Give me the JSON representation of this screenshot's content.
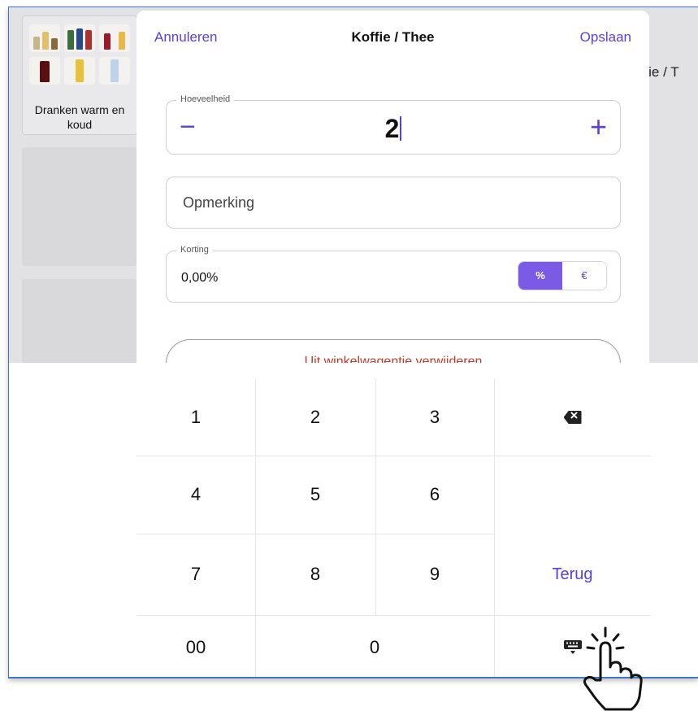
{
  "category": {
    "label": "Dranken warm en koud"
  },
  "background": {
    "peek_title": "ffie / T"
  },
  "modal": {
    "cancel": "Annuleren",
    "title": "Koffie / Thee",
    "save": "Opslaan",
    "quantity": {
      "legend": "Hoeveelheid",
      "value": "2",
      "minus": "−",
      "plus": "+"
    },
    "remark": {
      "placeholder": "Opmerking"
    },
    "discount": {
      "legend": "Korting",
      "value": "0,00%",
      "percent": "%",
      "euro": "€"
    },
    "remove_button": "Uit winkelwagentje verwijderen"
  },
  "keypad": {
    "keys": [
      "1",
      "2",
      "3",
      "4",
      "5",
      "6",
      "7",
      "8",
      "9",
      "00",
      "0"
    ],
    "back": "Terug",
    "icons": {
      "backspace": "backspace-icon",
      "hide_keyboard": "keyboard-hide-icon",
      "cursor": "pointing-hand-icon"
    }
  },
  "colors": {
    "accent": "#5b3fd6",
    "toggle_active": "#7b5be6",
    "danger": "#c0392b"
  }
}
